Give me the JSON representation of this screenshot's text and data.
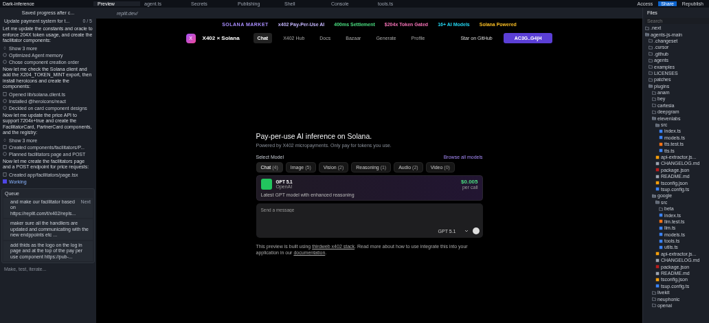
{
  "top_bar": {
    "project": "Dark-inference",
    "tabs": [
      {
        "label": "Preview",
        "selected": true
      },
      {
        "label": "agent.ts",
        "selected": false
      },
      {
        "label": "Secrets",
        "selected": false
      },
      {
        "label": "Publishing",
        "selected": false
      },
      {
        "label": "Shell",
        "selected": false
      },
      {
        "label": "Console",
        "selected": false
      },
      {
        "label": "tools.ts",
        "selected": false
      }
    ],
    "actions": [
      {
        "label": "Access",
        "primary": false
      },
      {
        "label": "Share",
        "primary": true
      },
      {
        "label": "Republish",
        "primary": false
      }
    ]
  },
  "agent": {
    "title": "Saved progress after c...",
    "task": {
      "title": "Update payment system for t...",
      "count": "0 / 5"
    },
    "items": [
      {
        "kind": "text",
        "text": "Let me update the constants and oracle to enforce 204X token usage, and create the facilitator components:"
      },
      {
        "kind": "more",
        "text": "Show 3 more"
      },
      {
        "kind": "step",
        "text": "Optimized Agent memory"
      },
      {
        "kind": "step",
        "text": "Chose component creation order"
      },
      {
        "kind": "text",
        "text": "Now let me check the Solana client and add the X204_TOKEN_MINT export, then install heroicons and create the components:"
      },
      {
        "kind": "file",
        "text": "Opened lib/solana.client.ts"
      },
      {
        "kind": "install",
        "text": "Installed @heroicons/react"
      },
      {
        "kind": "step",
        "text": "Decided on card component designs"
      },
      {
        "kind": "text",
        "text": "Now let me update the price API to support 7204x+true and create the FacilitatorCard, PartnerCard components, and the registry:"
      },
      {
        "kind": "more",
        "text": "Show 3 more"
      },
      {
        "kind": "file",
        "text": "Created components/facilitators/P..."
      },
      {
        "kind": "step",
        "text": "Planned facilitators page and POST"
      },
      {
        "kind": "text",
        "text": "Now let me create the facilitators page and a POST endpoint for price requests:"
      },
      {
        "kind": "file",
        "text": "Created app/facilitators/page.tsx"
      },
      {
        "kind": "working",
        "text": "Working"
      }
    ],
    "queue": {
      "title": "Queue",
      "items": [
        {
          "text": "and make our facilitator  based on https://replit.com/t/x402/repls...",
          "tag": "Next"
        },
        {
          "text": "maker sure all the handliers are updated and communicating with the new endppoints etc ..."
        },
        {
          "text": "add thids as the logo on the log in page and at the top of the pay per use component https://pub-..."
        }
      ]
    },
    "input": {
      "placeholder": "Make, test, iterate..."
    }
  },
  "browser": {
    "url": "replit.dev/"
  },
  "site": {
    "banner": [
      {
        "text": "SOLANA MARKET",
        "color": "#a78bfa"
      },
      {
        "text": "x402 Pay-Per-Use AI",
        "color": "#c4b5fd"
      },
      {
        "text": "400ms Settlement",
        "color": "#4ade80"
      },
      {
        "text": "$204x Token Gated",
        "color": "#f472b6"
      },
      {
        "text": "16+ AI Models",
        "color": "#22d3ee"
      },
      {
        "text": "Solana Powered",
        "color": "#fbbf24"
      }
    ],
    "brand": {
      "logo": "X",
      "name": "X402 × Solana"
    },
    "nav": [
      {
        "label": "Chat",
        "selected": true
      },
      {
        "label": "X402 Hub",
        "selected": false
      },
      {
        "label": "Docs",
        "selected": false
      },
      {
        "label": "Bazaar",
        "selected": false
      },
      {
        "label": "Generate",
        "selected": false
      },
      {
        "label": "Profile",
        "selected": false
      }
    ],
    "github": "Star on GitHub",
    "wallet": "AC3G..G4jH",
    "hero": {
      "title": "Pay-per-use AI inference on Solana.",
      "subtitle": "Powered by X402 micropayments. Only pay for tokens you use."
    },
    "select_label": "Select Model",
    "browse": "Browse all models",
    "categories": [
      {
        "label": "Chat",
        "count": "(4)",
        "selected": true
      },
      {
        "label": "Image",
        "count": "(5)",
        "selected": false
      },
      {
        "label": "Vision",
        "count": "(2)",
        "selected": false
      },
      {
        "label": "Reasoning",
        "count": "(1)",
        "selected": false
      },
      {
        "label": "Audio",
        "count": "(2)",
        "selected": false
      },
      {
        "label": "Video",
        "count": "(0)",
        "selected": false
      }
    ],
    "model": {
      "name": "GPT 5.1",
      "provider": "OpenAI",
      "price": "$0.005",
      "unit": "per call",
      "description": "Latest GPT model with enhanced reasoning"
    },
    "composer": {
      "placeholder": "Send a message",
      "model": "GPT 5.1"
    },
    "footer": {
      "before": "This preview is built using ",
      "link1": "thirdweb x402 stack",
      "middle": ". Read more about how to use integrate this into your application in our ",
      "link2": "documentation",
      "after": "."
    }
  },
  "files": {
    "title": "Files",
    "search": {
      "placeholder": "Search"
    },
    "tree": [
      {
        "name": ".next",
        "kind": "folder",
        "expanded": false
      },
      {
        "name": "agents-js-main",
        "kind": "folder",
        "expanded": true,
        "children": [
          {
            "name": ".changeset",
            "kind": "folder",
            "expanded": false
          },
          {
            "name": ".cursor",
            "kind": "folder",
            "expanded": false
          },
          {
            "name": ".github",
            "kind": "folder",
            "expanded": false
          },
          {
            "name": "agents",
            "kind": "folder",
            "expanded": false
          },
          {
            "name": "examples",
            "kind": "folder",
            "expanded": false
          },
          {
            "name": "LICENSES",
            "kind": "folder",
            "expanded": false
          },
          {
            "name": "patches",
            "kind": "folder",
            "expanded": false
          },
          {
            "name": "plugins",
            "kind": "folder",
            "expanded": true,
            "children": [
              {
                "name": "anam",
                "kind": "folder",
                "expanded": false
              },
              {
                "name": "bey",
                "kind": "folder",
                "expanded": false
              },
              {
                "name": "cartesia",
                "kind": "folder",
                "expanded": false
              },
              {
                "name": "deepgram",
                "kind": "folder",
                "expanded": false
              },
              {
                "name": "elevenlabs",
                "kind": "folder",
                "expanded": true,
                "children": [
                  {
                    "name": "src",
                    "kind": "folder",
                    "expanded": true,
                    "children": [
                      {
                        "name": "index.ts",
                        "kind": "ts"
                      },
                      {
                        "name": "models.ts",
                        "kind": "ts"
                      },
                      {
                        "name": "tts.test.ts",
                        "kind": "test"
                      },
                      {
                        "name": "tts.ts",
                        "kind": "ts"
                      }
                    ]
                  },
                  {
                    "name": "api-extractor.js...",
                    "kind": "config"
                  },
                  {
                    "name": "CHANGELOG.md",
                    "kind": "md"
                  },
                  {
                    "name": "package.json",
                    "kind": "json"
                  },
                  {
                    "name": "README.md",
                    "kind": "md"
                  },
                  {
                    "name": "tsconfig.json",
                    "kind": "config"
                  },
                  {
                    "name": "tsup.config.ts",
                    "kind": "ts"
                  }
                ]
              },
              {
                "name": "google",
                "kind": "folder",
                "expanded": true,
                "children": [
                  {
                    "name": "src",
                    "kind": "folder",
                    "expanded": true,
                    "children": [
                      {
                        "name": "beta",
                        "kind": "folder",
                        "expanded": false
                      },
                      {
                        "name": "index.ts",
                        "kind": "ts"
                      },
                      {
                        "name": "llm.test.ts",
                        "kind": "test"
                      },
                      {
                        "name": "llm.ts",
                        "kind": "ts"
                      },
                      {
                        "name": "models.ts",
                        "kind": "ts"
                      },
                      {
                        "name": "tools.ts",
                        "kind": "ts"
                      },
                      {
                        "name": "utils.ts",
                        "kind": "ts"
                      }
                    ]
                  },
                  {
                    "name": "api-extractor.js...",
                    "kind": "config"
                  },
                  {
                    "name": "CHANGELOG.md",
                    "kind": "md"
                  },
                  {
                    "name": "package.json",
                    "kind": "json"
                  },
                  {
                    "name": "README.md",
                    "kind": "md"
                  },
                  {
                    "name": "tsconfig.json",
                    "kind": "config"
                  },
                  {
                    "name": "tsup.config.ts",
                    "kind": "ts"
                  }
                ]
              },
              {
                "name": "livekit",
                "kind": "folder",
                "expanded": false
              },
              {
                "name": "neuphonic",
                "kind": "folder",
                "expanded": false
              },
              {
                "name": "openai",
                "kind": "folder",
                "expanded": false
              }
            ]
          }
        ]
      }
    ]
  }
}
